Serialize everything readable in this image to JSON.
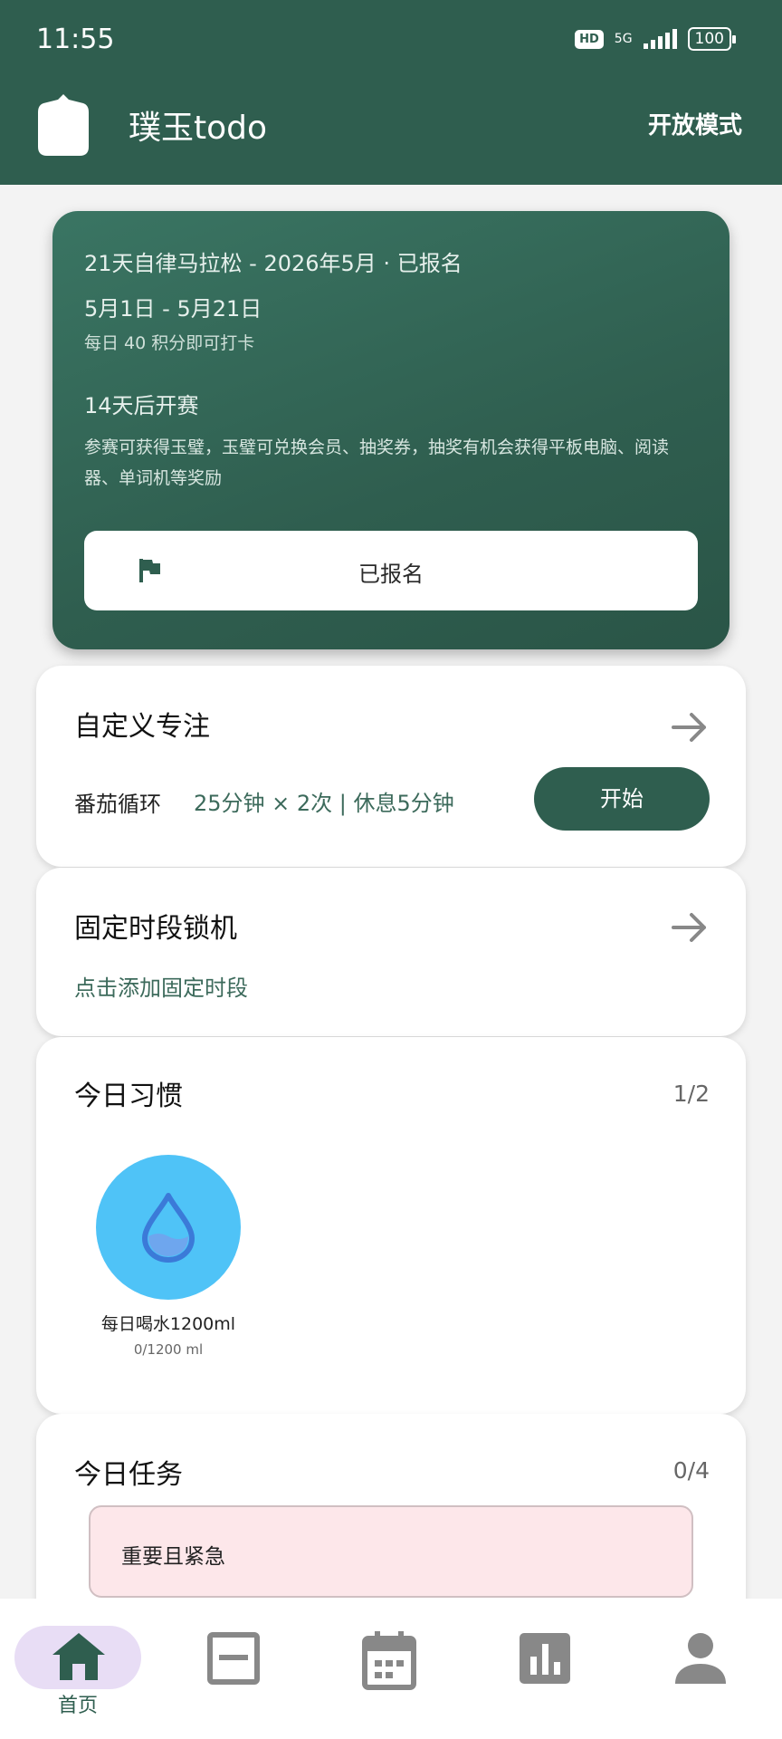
{
  "status_bar": {
    "time": "11:55",
    "hd": "HD",
    "network": "5G",
    "battery": "100"
  },
  "header": {
    "title": "璞玉todo",
    "mode_button": "开放模式"
  },
  "hero": {
    "event_title": "21天自律马拉松 - 2026年5月 · 已报名",
    "date_range": "5月1日 - 5月21日",
    "requirement": "每日 40 积分即可打卡",
    "countdown": "14天后开赛",
    "reward_desc": "参赛可获得玉璧，玉璧可兑换会员、抽奖券，抽奖有机会获得平板电脑、阅读器、单词机等奖励",
    "button_label": "已报名"
  },
  "focus": {
    "title": "自定义专注",
    "mode_label": "番茄循环",
    "mode_detail": "25分钟 × 2次 | 休息5分钟",
    "start_label": "开始"
  },
  "fixed_lock": {
    "title": "固定时段锁机",
    "add_label": "点击添加固定时段"
  },
  "habits": {
    "title": "今日习惯",
    "count": "1/2",
    "items": [
      {
        "name": "每日喝水1200ml",
        "progress": "0/1200 ml",
        "icon": "water-drop-icon",
        "color": "#4fc3f7"
      }
    ]
  },
  "tasks": {
    "title": "今日任务",
    "count": "0/4",
    "quadrants": [
      {
        "label": "重要且紧急"
      }
    ]
  },
  "bottom_nav": {
    "items": [
      {
        "label": "首页",
        "icon": "home-icon",
        "active": true
      },
      {
        "icon": "note-icon"
      },
      {
        "icon": "calendar-icon"
      },
      {
        "icon": "stats-icon"
      },
      {
        "icon": "profile-icon"
      }
    ]
  },
  "colors": {
    "primary": "#2f5e4f",
    "accent_text": "#3c6a5b",
    "urgent_bg": "#fde7ea",
    "nav_active_bg": "#e8ddf5"
  }
}
